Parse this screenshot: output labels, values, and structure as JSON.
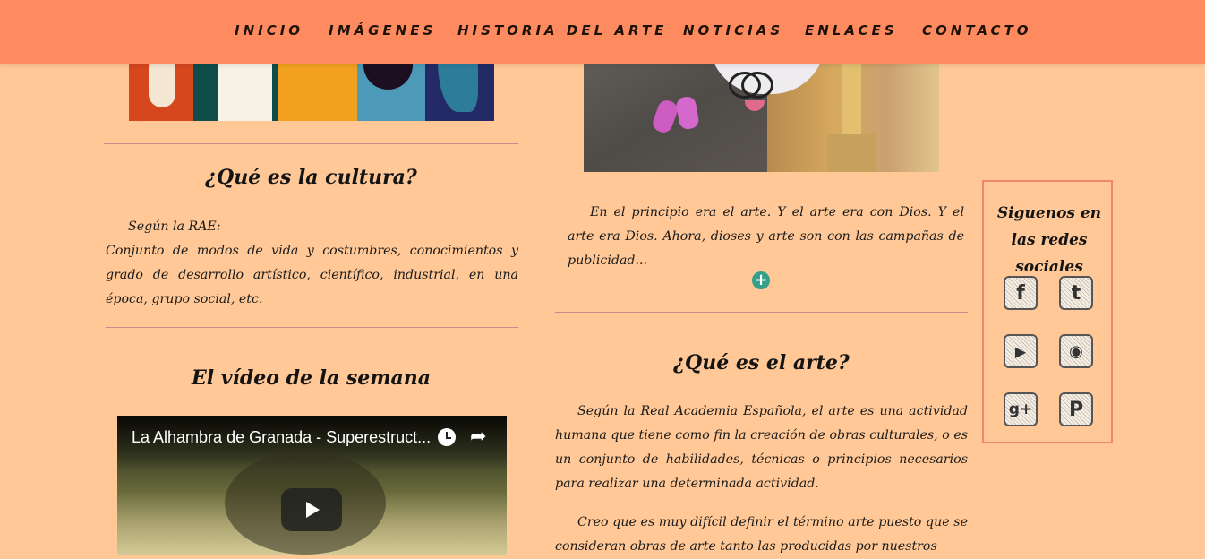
{
  "nav": {
    "items": [
      "INICIO",
      "IMÁGENES",
      "HISTORIA DEL ARTE",
      "NOTICIAS",
      "ENLACES",
      "CONTACTO"
    ]
  },
  "left": {
    "culture_title": "¿Qué es la cultura?",
    "culture_lead": "Según la RAE:",
    "culture_text": "Conjunto de modos de vida y costumbres, conocimientos y grado de desarrollo artístico, científico, industrial, en una época, grupo social, etc.",
    "video_section_title": "El vídeo de la semana",
    "video_title": "La Alhambra de Granada - Superestruct..."
  },
  "right": {
    "intro_text": "En el principio era el arte. Y el arte era con Dios. Y el arte era Dios. Ahora, dioses y arte son con las campañas de publicidad...",
    "more_symbol": "+",
    "art_title": "¿Qué es el arte?",
    "art_text_1": "Según la Real Academia Española, el arte es una actividad humana que tiene como fin la creación de obras culturales, o es un conjunto de habilidades, técnicas o principios necesarios para realizar una determinada actividad.",
    "art_text_2": "Creo que es muy difícil definir el término arte puesto que se consideran obras de arte tanto las producidas por nuestros"
  },
  "social": {
    "title": "Siguenos en las redes sociales",
    "icons": [
      "facebook-icon",
      "tumblr-icon",
      "youtube-icon",
      "instagram-icon",
      "google-plus-icon",
      "pinterest-icon"
    ],
    "glyphs": [
      "f",
      "t",
      "▶",
      "◉",
      "g+",
      "P"
    ]
  },
  "colors": {
    "background": "#ffc896",
    "nav_background": "#fe8b5f",
    "divider": "#c48d8d",
    "plus_button": "#33a08a",
    "social_border": "#f0876a"
  }
}
